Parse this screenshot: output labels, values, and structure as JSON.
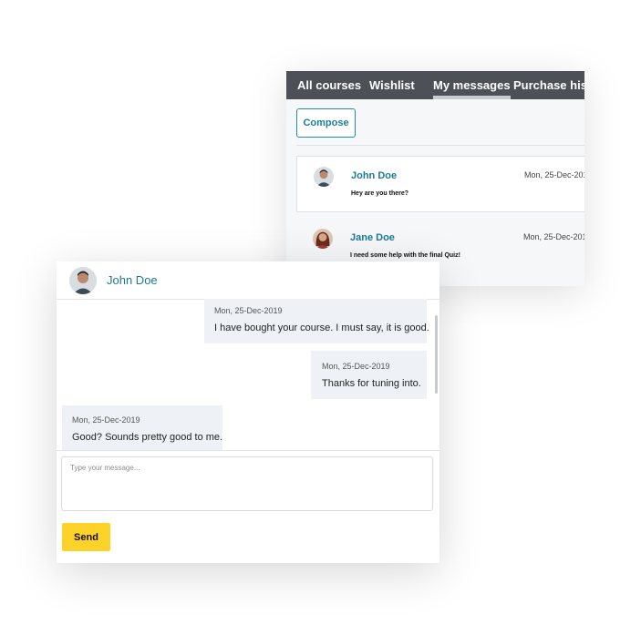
{
  "messages_page": {
    "tabs": [
      {
        "label": "All courses",
        "active": false
      },
      {
        "label": "Wishlist",
        "active": false
      },
      {
        "label": "My messages",
        "active": true
      },
      {
        "label": "Purchase histo",
        "active": false
      }
    ],
    "compose_label": "Compose",
    "threads": [
      {
        "name": "John Doe",
        "preview": "Hey are you there?",
        "date": "Mon, 25-Dec-201"
      },
      {
        "name": "Jane Doe",
        "preview": "I need some help with the final Quiz!",
        "date": "Mon, 25-Dec-201"
      }
    ]
  },
  "chat": {
    "contact_name": "John Doe",
    "messages": [
      {
        "date": "Mon, 25-Dec-2019",
        "text": "I have bought your course. I must say, it is good.",
        "side": "right"
      },
      {
        "date": "Mon, 25-Dec-2019",
        "text": "Thanks for tuning into.",
        "side": "right"
      },
      {
        "date": "Mon, 25-Dec-2019",
        "text": "Good? Sounds pretty good to me.",
        "side": "left"
      }
    ],
    "input_placeholder": "Type your message...",
    "send_label": "Send"
  },
  "colors": {
    "tab_bar": "#4d5057",
    "accent_teal": "#1b7a92",
    "bubble_bg": "#eef2f6",
    "send_button": "#fdd32a"
  }
}
